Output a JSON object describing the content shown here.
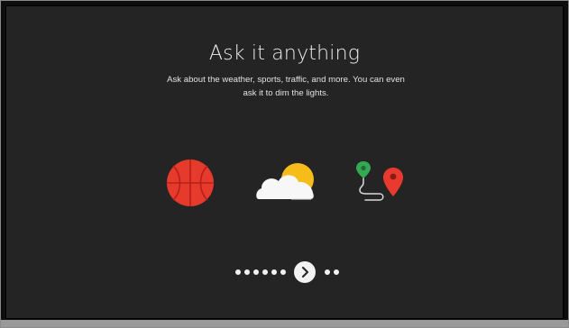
{
  "onboarding": {
    "title": "Ask it anything",
    "subtitle": "Ask about the weather, sports, traffic, and more. You can even ask it to dim the lights."
  },
  "icons": [
    {
      "name": "basketball-icon",
      "color": "#e53a2c"
    },
    {
      "name": "weather-sun-cloud-icon",
      "sun_color": "#f6bd1a",
      "cloud_color": "#f7f7f7"
    },
    {
      "name": "map-route-icon",
      "green_pin": "#34a853",
      "red_pin": "#ea3a2f"
    }
  ],
  "pager": {
    "total_pages": 9,
    "current_page": 7,
    "next_icon": "chevron-right-icon"
  },
  "colors": {
    "background": "#242424",
    "text": "#ececec"
  }
}
